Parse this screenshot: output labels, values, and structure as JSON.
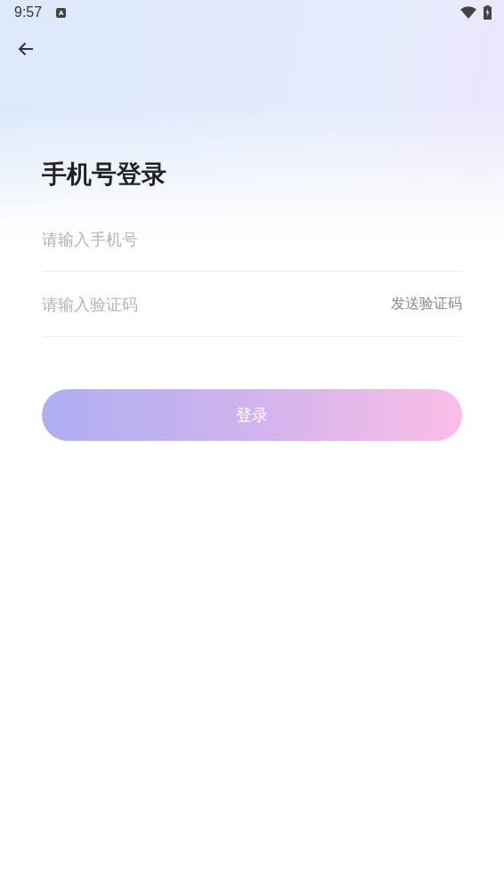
{
  "status_bar": {
    "time": "9:57",
    "indicator": "A"
  },
  "title": "手机号登录",
  "phone_field": {
    "placeholder": "请输入手机号"
  },
  "code_field": {
    "placeholder": "请输入验证码",
    "action": "发送验证码"
  },
  "login_button": {
    "label": "登录"
  }
}
